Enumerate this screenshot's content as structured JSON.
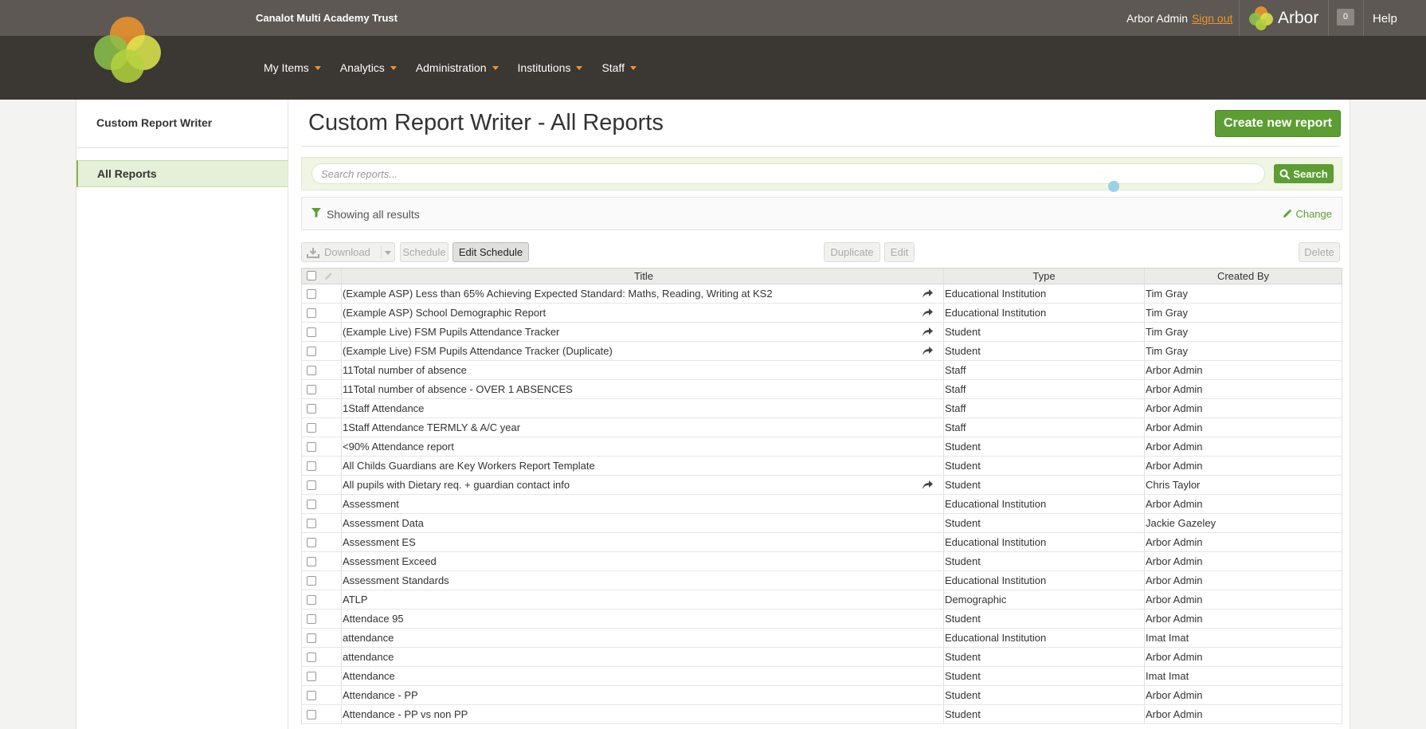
{
  "header": {
    "org_name": "Canalot Multi Academy Trust",
    "user_name": "Arbor Admin",
    "sign_out": "Sign out",
    "brand": "Arbor",
    "notifications": "0",
    "help": "Help"
  },
  "nav": {
    "items": [
      "My Items",
      "Analytics",
      "Administration",
      "Institutions",
      "Staff"
    ]
  },
  "sidebar": {
    "title": "Custom Report Writer",
    "items": [
      {
        "label": "All Reports",
        "selected": true
      }
    ]
  },
  "main": {
    "title": "Custom Report Writer - All Reports",
    "create_button": "Create new report",
    "search": {
      "placeholder": "Search reports...",
      "button": "Search"
    },
    "filter": {
      "text": "Showing all results",
      "change": "Change"
    },
    "toolbar": {
      "download": "Download",
      "schedule": "Schedule",
      "edit_schedule": "Edit Schedule",
      "duplicate": "Duplicate",
      "edit": "Edit",
      "delete": "Delete"
    },
    "table": {
      "columns": [
        "Title",
        "Type",
        "Created By"
      ],
      "rows": [
        {
          "title": "(Example ASP) Less than 65% Achieving Expected Standard: Maths, Reading, Writing at KS2",
          "type": "Educational Institution",
          "created_by": "Tim Gray",
          "shared": true
        },
        {
          "title": "(Example ASP) School Demographic Report",
          "type": "Educational Institution",
          "created_by": "Tim Gray",
          "shared": true
        },
        {
          "title": "(Example Live) FSM Pupils Attendance Tracker",
          "type": "Student",
          "created_by": "Tim Gray",
          "shared": true
        },
        {
          "title": "(Example Live) FSM Pupils Attendance Tracker (Duplicate)",
          "type": "Student",
          "created_by": "Tim Gray",
          "shared": true
        },
        {
          "title": "11Total number of absence",
          "type": "Staff",
          "created_by": "Arbor Admin",
          "shared": false
        },
        {
          "title": "11Total number of absence - OVER 1 ABSENCES",
          "type": "Staff",
          "created_by": "Arbor Admin",
          "shared": false
        },
        {
          "title": "1Staff Attendance",
          "type": "Staff",
          "created_by": "Arbor Admin",
          "shared": false
        },
        {
          "title": "1Staff Attendance TERMLY & A/C year",
          "type": "Staff",
          "created_by": "Arbor Admin",
          "shared": false
        },
        {
          "title": "<90% Attendance report",
          "type": "Student",
          "created_by": "Arbor Admin",
          "shared": false
        },
        {
          "title": "All Childs Guardians are Key Workers Report Template",
          "type": "Student",
          "created_by": "Arbor Admin",
          "shared": false
        },
        {
          "title": "All pupils with Dietary req. + guardian contact info",
          "type": "Student",
          "created_by": "Chris Taylor",
          "shared": true
        },
        {
          "title": "Assessment",
          "type": "Educational Institution",
          "created_by": "Arbor Admin",
          "shared": false
        },
        {
          "title": "Assessment Data",
          "type": "Student",
          "created_by": "Jackie Gazeley",
          "shared": false
        },
        {
          "title": "Assessment ES",
          "type": "Educational Institution",
          "created_by": "Arbor Admin",
          "shared": false
        },
        {
          "title": "Assessment Exceed",
          "type": "Student",
          "created_by": "Arbor Admin",
          "shared": false
        },
        {
          "title": "Assessment Standards",
          "type": "Educational Institution",
          "created_by": "Arbor Admin",
          "shared": false
        },
        {
          "title": "ATLP",
          "type": "Demographic",
          "created_by": "Arbor Admin",
          "shared": false
        },
        {
          "title": "Attendace 95",
          "type": "Student",
          "created_by": "Arbor Admin",
          "shared": false
        },
        {
          "title": "attendance",
          "type": "Educational Institution",
          "created_by": "Imat Imat",
          "shared": false
        },
        {
          "title": "attendance",
          "type": "Student",
          "created_by": "Arbor Admin",
          "shared": false
        },
        {
          "title": "Attendance",
          "type": "Student",
          "created_by": "Imat Imat",
          "shared": false
        },
        {
          "title": "Attendance - PP",
          "type": "Student",
          "created_by": "Arbor Admin",
          "shared": false
        },
        {
          "title": "Attendance - PP vs non PP",
          "type": "Student",
          "created_by": "Arbor Admin",
          "shared": false
        }
      ]
    }
  },
  "colors": {
    "accent_green": "#5c9e33",
    "accent_orange": "#f0952b",
    "topbar": "#5d5853",
    "navbar": "#3b3733"
  }
}
